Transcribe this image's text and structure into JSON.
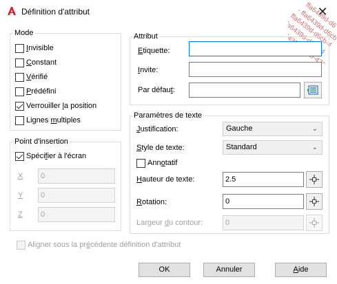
{
  "window": {
    "title": "Définition d'attribut",
    "close_glyph": "✕",
    "watermark_lines": [
      "ffa6439d-d6",
      "- ffa6439d-d6cb-",
      "ffa6439d-d6cb-4",
      "ffa6439d-d6cb-4",
      "ffa6439d-d6cb-476"
    ]
  },
  "mode": {
    "title": "Mode",
    "options": [
      {
        "pre": "",
        "key": "I",
        "post": "nvisible",
        "checked": false
      },
      {
        "pre": "",
        "key": "C",
        "post": "onstant",
        "checked": false
      },
      {
        "pre": "",
        "key": "V",
        "post": "érifié",
        "checked": false
      },
      {
        "pre": "",
        "key": "P",
        "post": "rédéfini",
        "checked": false
      },
      {
        "pre": "Verrouiller ",
        "key": "l",
        "post": "a position",
        "checked": true
      },
      {
        "pre": "Lignes ",
        "key": "m",
        "post": "ultiples",
        "checked": false
      }
    ]
  },
  "insertion": {
    "title": "Point d'insertion",
    "specify": {
      "pre": "Spéci",
      "key": "f",
      "post": "ier à l'écran",
      "checked": true
    },
    "x": {
      "label": "X",
      "value": "0"
    },
    "y": {
      "label": "Y",
      "value": "0"
    },
    "z": {
      "label": "Z",
      "value": "0"
    }
  },
  "attribute": {
    "title": "Attribut",
    "tag": {
      "pre": "",
      "key": "E",
      "post": "tiquette:",
      "value": ""
    },
    "prompt": {
      "pre": "",
      "key": "I",
      "post": "nvite:",
      "value": ""
    },
    "default": {
      "pre": "Par défau",
      "key": "t",
      "post": ":",
      "value": ""
    }
  },
  "text_settings": {
    "title": "Paramètres de texte",
    "justification": {
      "pre": "",
      "key": "J",
      "post": "ustification:",
      "value": "Gauche"
    },
    "style": {
      "pre": "",
      "key": "S",
      "post": "tyle de texte:",
      "value": "Standard"
    },
    "annotative": {
      "pre": "Ann",
      "key": "o",
      "post": "tatif",
      "checked": false
    },
    "height": {
      "pre": "",
      "key": "H",
      "post": "auteur de texte:",
      "value": "2.5"
    },
    "rotation": {
      "pre": "",
      "key": "R",
      "post": "otation:",
      "value": "0"
    },
    "boundary": {
      "pre": "Largeur ",
      "key": "d",
      "post": "u contour:",
      "value": "0"
    }
  },
  "align": {
    "pre": "Aligner sous la pr",
    "key": "é",
    "post": "cédente définition d'attribut",
    "checked": false
  },
  "buttons": {
    "ok": "OK",
    "cancel": "Annuler",
    "help_key": "A",
    "help_rest": "ide"
  },
  "colors": {
    "accent": "#0078d7",
    "logo": "#d21f26"
  },
  "icons": {
    "logo": "autocad-logo-icon",
    "pick": "crosshair-pick-icon",
    "insert_field": "insert-field-icon",
    "dropdown": "chevron-down-icon"
  }
}
